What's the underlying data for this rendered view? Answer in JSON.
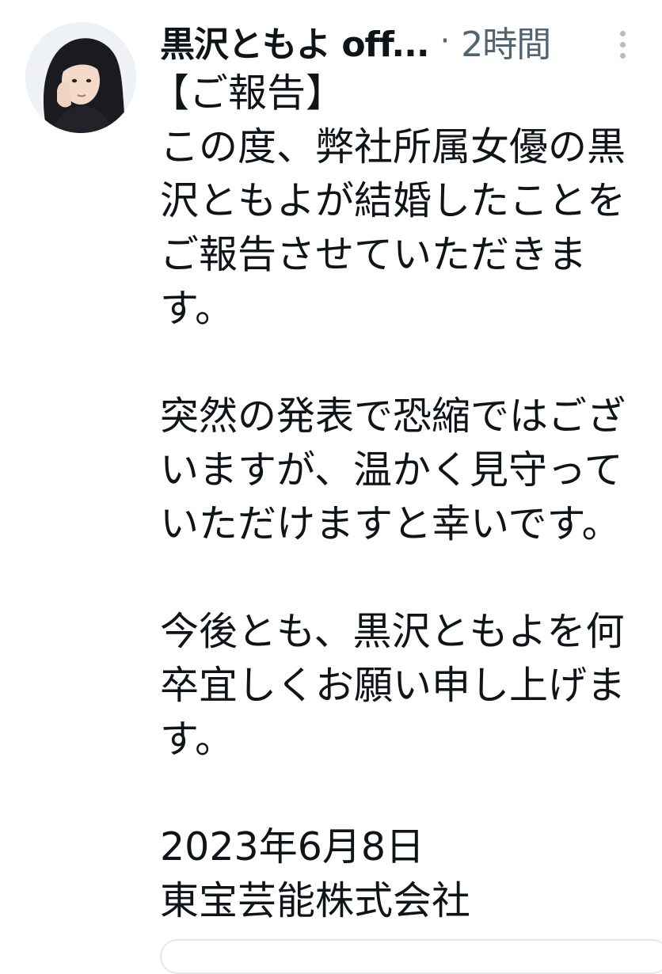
{
  "author": {
    "name": "黒沢ともよ off...",
    "separator": "·",
    "time": "2時間"
  },
  "more_icon": "more-vertical-icon",
  "avatar_icon": "user-avatar",
  "tweet": {
    "lines": [
      "【ご報告】",
      "この度、弊社所属女優の黒",
      "沢ともよが結婚したことを",
      "ご報告させていただきま",
      "す。",
      "",
      "突然の発表で恐縮ではござ",
      "いますが、温かく見守って",
      "いただけますと幸いです。",
      "",
      "今後とも、黒沢ともよを何",
      "卒宜しくお願い申し上げま",
      "す。",
      "",
      "2023年6月8日",
      "東宝芸能株式会社"
    ]
  },
  "colors": {
    "text": "#0f1419",
    "muted": "#536471",
    "border": "#e3e8ec"
  }
}
